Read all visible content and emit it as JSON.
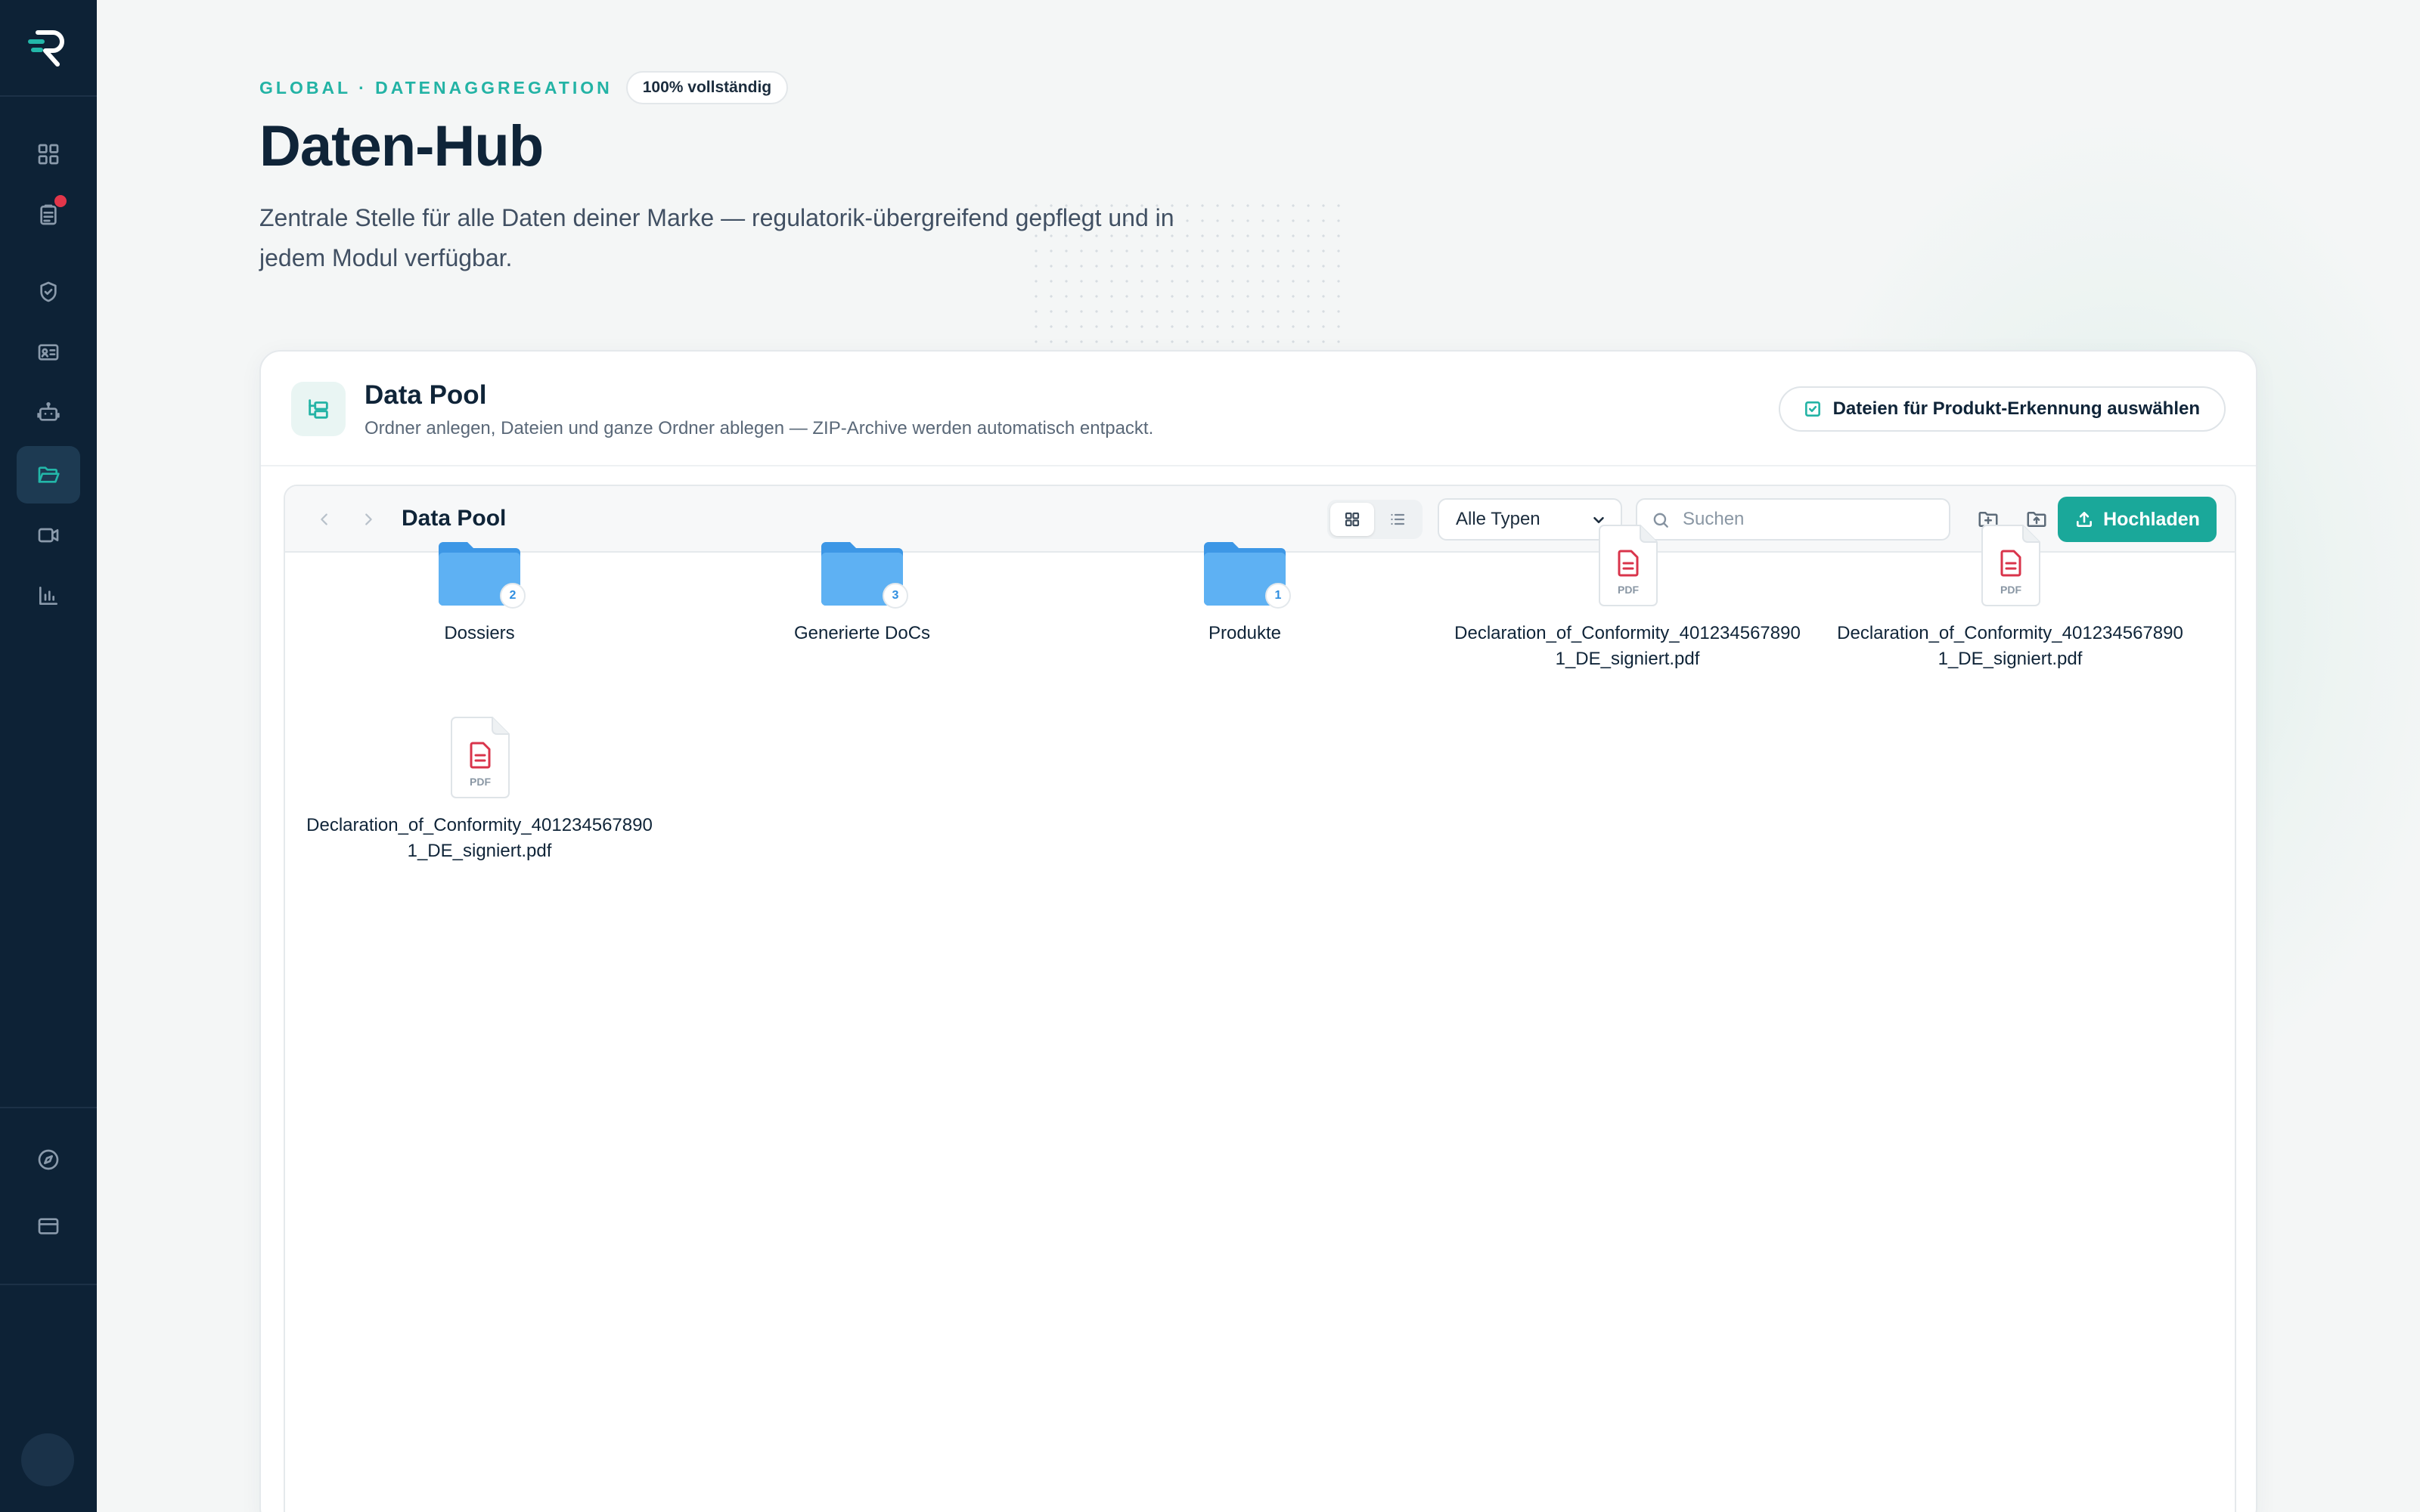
{
  "sidebar": {
    "logo_icon": "brand-r-icon",
    "nav_top": [
      {
        "icon": "dashboard-grid-icon",
        "active": false
      },
      {
        "icon": "clipboard-list-icon",
        "active": false,
        "has_notification": true
      },
      {
        "icon": "shield-check-icon",
        "active": false
      },
      {
        "icon": "id-card-icon",
        "active": false
      },
      {
        "icon": "robot-icon",
        "active": false
      },
      {
        "icon": "folder-open-icon",
        "active": true
      },
      {
        "icon": "video-icon",
        "active": false
      },
      {
        "icon": "bar-chart-icon",
        "active": false
      }
    ],
    "nav_bottom": [
      {
        "icon": "compass-icon"
      },
      {
        "icon": "credit-card-icon"
      }
    ]
  },
  "header": {
    "eyebrow": "GLOBAL · DATENAGGREGATION",
    "completion_badge": "100% vollständig",
    "title": "Daten-Hub",
    "description_line1": "Zentrale Stelle für alle Daten deiner Marke — regulatorik-übergreifend gepflegt und in",
    "description_line2": "jedem Modul verfügbar."
  },
  "card": {
    "title": "Data Pool",
    "subtitle": "Ordner anlegen, Dateien und ganze Ordner ablegen — ZIP-Archive werden automatisch entpackt.",
    "select_files_label": "Dateien für Produkt-Erkennung auswählen"
  },
  "explorer": {
    "current_folder": "Data Pool",
    "view_mode": "grid",
    "type_filter": "Alle Typen",
    "search_placeholder": "Suchen",
    "upload_label": "Hochladen",
    "items": [
      {
        "kind": "folder",
        "name": "Dossiers",
        "count": "2"
      },
      {
        "kind": "folder",
        "name": "Generierte DoCs",
        "count": "3"
      },
      {
        "kind": "folder",
        "name": "Produkte",
        "count": "1"
      },
      {
        "kind": "pdf",
        "name": "Declaration_of_Conformity_4012345678901_DE_signiert.pdf",
        "tag": "PDF"
      },
      {
        "kind": "pdf",
        "name": "Declaration_of_Conformity_4012345678901_DE_signiert.pdf",
        "tag": "PDF"
      },
      {
        "kind": "pdf",
        "name": "Declaration_of_Conformity_4012345678901_DE_signiert.pdf",
        "tag": "PDF"
      }
    ]
  },
  "colors": {
    "sidebar_bg": "#0d2236",
    "accent": "#1aa89a",
    "folder": "#4aa3ec",
    "pdf_red": "#d9344b",
    "notification": "#e2364a"
  }
}
